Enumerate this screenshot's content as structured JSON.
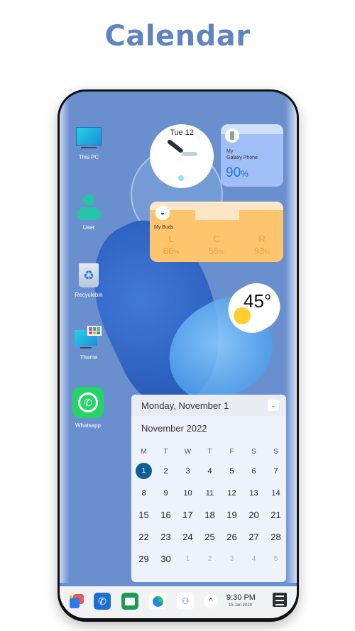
{
  "page_title": "Calendar",
  "desktop_icons": [
    {
      "label": "This PC",
      "icon": "monitor-icon"
    },
    {
      "label": "User",
      "icon": "user-icon"
    },
    {
      "label": "Recyclebin",
      "icon": "recycle-bin-icon"
    },
    {
      "label": "Theme",
      "icon": "theme-icon"
    },
    {
      "label": "Whatsapp",
      "icon": "whatsapp-icon"
    }
  ],
  "clock_widget": {
    "date": "Tue 12"
  },
  "phone_widget": {
    "name_line1": "My",
    "name_line2": "Galaxy Phone",
    "battery": "90",
    "unit": "%"
  },
  "buds_widget": {
    "name": "My Buds",
    "channels": [
      {
        "label": "L",
        "value": "86",
        "unit": "%"
      },
      {
        "label": "C",
        "value": "55",
        "unit": "%"
      },
      {
        "label": "R",
        "value": "93",
        "unit": "%"
      }
    ]
  },
  "weather_widget": {
    "temp": "45°",
    "icon": "sun-icon"
  },
  "calendar": {
    "selected_date": "Monday, November 1",
    "month_label": "November 2022",
    "weekdays": [
      "M",
      "T",
      "W",
      "T",
      "F",
      "S",
      "S"
    ],
    "days": [
      [
        "1",
        "2",
        "3",
        "4",
        "5",
        "6",
        "7"
      ],
      [
        "8",
        "9",
        "10",
        "11",
        "12",
        "13",
        "14"
      ],
      [
        "15",
        "16",
        "17",
        "18",
        "19",
        "20",
        "21"
      ],
      [
        "22",
        "23",
        "24",
        "25",
        "26",
        "27",
        "28"
      ],
      [
        "29",
        "30",
        "1",
        "2",
        "3",
        "4",
        "5"
      ]
    ],
    "selected_day": "1",
    "accent": "#0d5e9a"
  },
  "taskbar": {
    "apps": [
      "start-icon",
      "phone-icon",
      "messages-icon",
      "edge-icon",
      "teams-icon"
    ],
    "tray_chevron": "^",
    "time": "9:30 PM",
    "date": "15  Jan   2020"
  }
}
